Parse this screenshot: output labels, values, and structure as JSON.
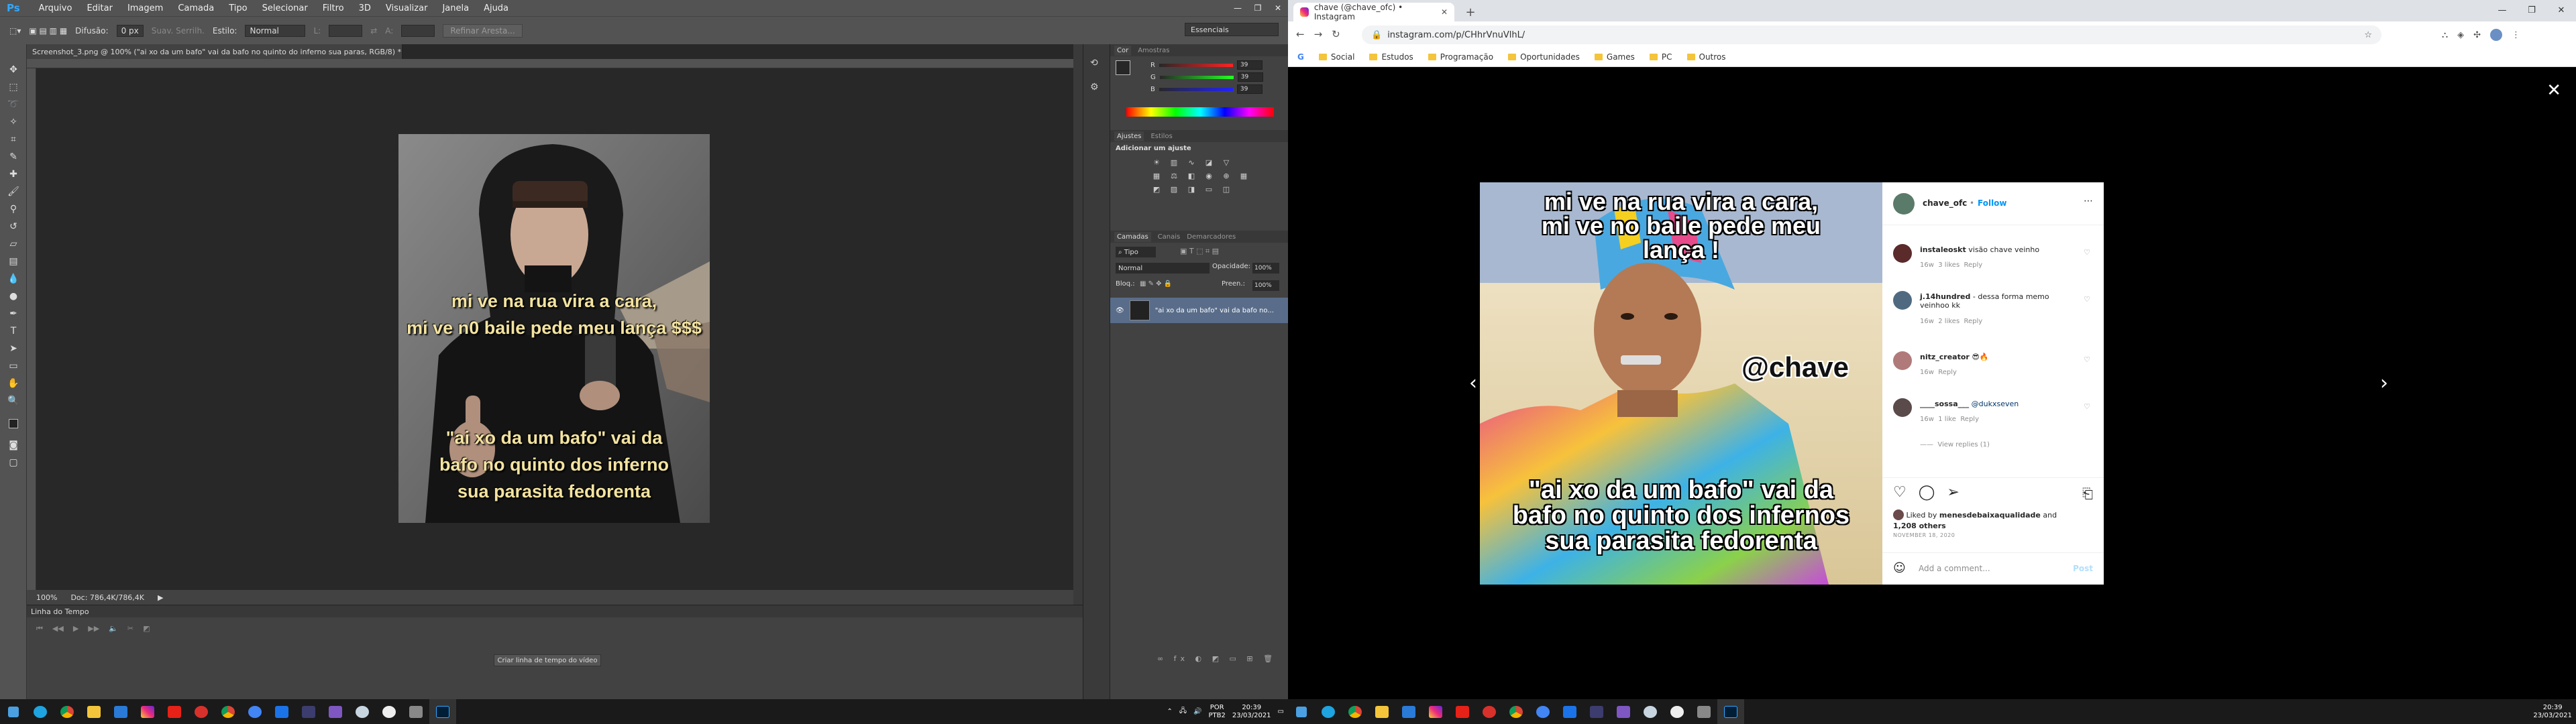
{
  "photoshop": {
    "menu": [
      "Arquivo",
      "Editar",
      "Imagem",
      "Camada",
      "Tipo",
      "Selecionar",
      "Filtro",
      "3D",
      "Visualizar",
      "Janela",
      "Ajuda"
    ],
    "options": {
      "difusao_label": "Difusão:",
      "difusao_value": "0 px",
      "suav": "Suav. Serrilh.",
      "estilo_label": "Estilo:",
      "estilo_value": "Normal",
      "l": "L:",
      "a": "A:",
      "refine": "Refinar Aresta...",
      "workspace": "Essenciais"
    },
    "doc_tab": "Screenshot_3.png @ 100% (\"ai xo da um bafo\" vai da bafo no quinto do inferno  sua paras, RGB/8) *",
    "status": {
      "zoom": "100%",
      "doc": "Doc: 786,4K/786,4K"
    },
    "timeline": {
      "title": "Linha do Tempo",
      "create_button": "Criar linha de tempo do vídeo"
    },
    "color_panel": {
      "tabs": [
        "Cor",
        "Amostras"
      ],
      "r": "39",
      "g": "39",
      "b": "39"
    },
    "adjust_panel": {
      "tabs": [
        "Ajustes",
        "Estilos"
      ],
      "title": "Adicionar um ajuste"
    },
    "layers_panel": {
      "tabs": [
        "Camadas",
        "Canais",
        "Demarcadores"
      ],
      "kind": "Tipo",
      "blend": "Normal",
      "opacity_label": "Opacidade:",
      "opacity": "100%",
      "lock_label": "Bloq.:",
      "fill_label": "Preen.:",
      "fill": "100%",
      "layer_name": "\"ai xo da um bafo\" vai da bafo no..."
    },
    "image_captions": {
      "top1": "mi ve na rua vira a cara,",
      "top2": "mi ve n0 baile pede meu lança $$$",
      "bot1": "\"ai xo da um bafo\" vai da",
      "bot2": "bafo no quinto dos inferno",
      "bot3": "sua parasita fedorenta"
    }
  },
  "chrome": {
    "tab_title": "chave (@chave_ofc) • Instagram",
    "url": "instagram.com/p/CHhrVnuVlhL/",
    "bookmarks": [
      "G",
      "Social",
      "Estudos",
      "Programação",
      "Oportunidades",
      "Games",
      "PC",
      "Outros"
    ],
    "post": {
      "captions": {
        "top1": "mi ve na rua vira a cara,",
        "top2": "mi ve no baile pede meu",
        "top3": "lança !",
        "mid": "@chave",
        "bot1": "\"ai xo da um bafo\" vai da",
        "bot2": "bafo no quinto dos infernos",
        "bot3": "sua parasita fedorenta"
      },
      "author": "chave_ofc",
      "follow": "Follow",
      "comments": [
        {
          "user": "instaleoskt",
          "text": "visão chave veinho",
          "time": "16w",
          "likes": "3 likes",
          "reply": "Reply"
        },
        {
          "user": "j.14hundred",
          "text": "- dessa forma memo veinhoo kk",
          "time": "16w",
          "likes": "2 likes",
          "reply": "Reply"
        },
        {
          "user": "nitz_creator",
          "text": "😎🔥",
          "time": "16w",
          "likes": "",
          "reply": "Reply"
        },
        {
          "user": "____sossa___",
          "text": "@dukxseven",
          "time": "16w",
          "likes": "1 like",
          "reply": "Reply"
        }
      ],
      "view_replies": "View replies (1)",
      "liked_by_prefix": "Liked by",
      "liked_by_user": "menesdebaixaqualidade",
      "liked_by_and": "and",
      "liked_by_others": "1,208 others",
      "date": "NOVEMBER 18, 2020",
      "comment_placeholder": "Add a comment...",
      "post_button": "Post"
    }
  },
  "taskbar": {
    "lang1": "POR",
    "lang2": "PTB2",
    "time": "20:39",
    "date": "23/03/2021"
  },
  "colors": {
    "ps_blue": "#31a8ff",
    "ig_blue": "#0095f6",
    "caption_yellow": "#f3e3a0"
  }
}
